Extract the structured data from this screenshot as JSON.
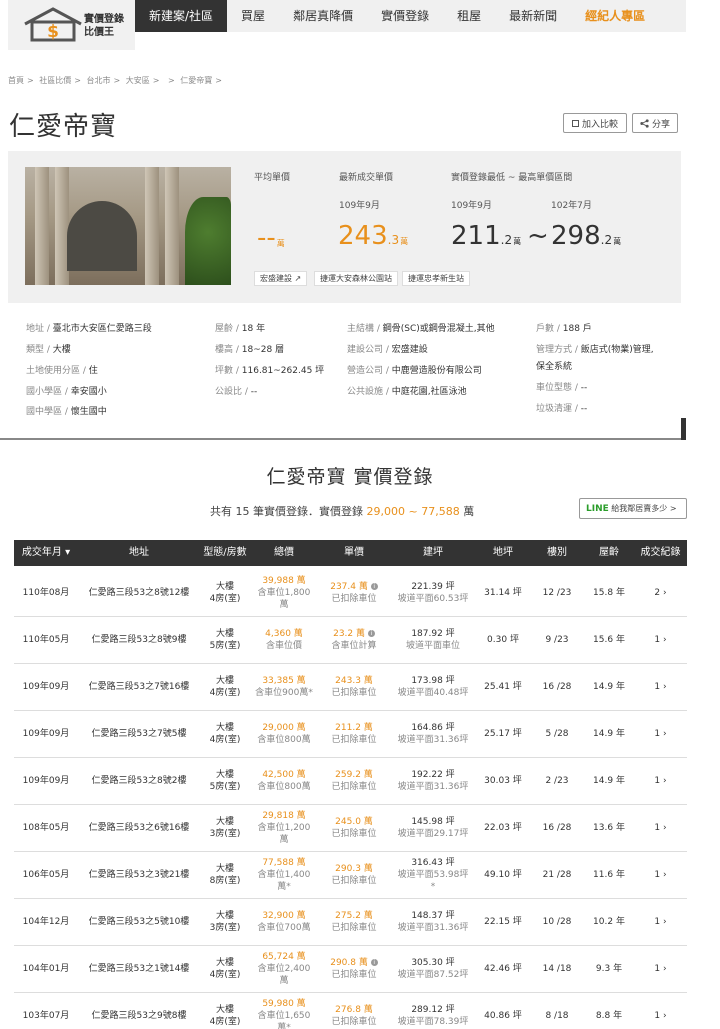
{
  "logo": {
    "line1": "實價登錄",
    "line2": "比價王"
  },
  "nav": [
    {
      "label": "新建案/社區",
      "active": true
    },
    {
      "label": "買屋"
    },
    {
      "label": "鄰居真降價"
    },
    {
      "label": "實價登錄"
    },
    {
      "label": "租屋"
    },
    {
      "label": "最新新聞"
    },
    {
      "label": "經紀人專區",
      "broker": true
    }
  ],
  "breadcrumb": [
    "首頁",
    "社區比價",
    "台北市",
    "大安區",
    "",
    "仁愛帝寶"
  ],
  "title": "仁愛帝寶",
  "buttons": {
    "compare": "加入比較",
    "share": "分享"
  },
  "summary": {
    "avg_label": "平均單價",
    "latest_label": "最新成交單價",
    "range_label": "實價登錄最低 ~ 最高單價區間",
    "avg_value": "--",
    "unit": "萬",
    "latest_date": "109年9月",
    "latest_int": "243",
    "latest_dec": ".3",
    "low_date": "109年9月",
    "low_int": "211",
    "low_dec": ".2",
    "tilde": "~",
    "high_date": "102年7月",
    "high_int": "298",
    "high_dec": ".2",
    "tags": [
      "宏盛建設",
      "捷運大安森林公園站",
      "捷運忠孝新生站"
    ]
  },
  "details": {
    "c1": [
      {
        "k": "地址 / ",
        "v": "臺北市大安區仁愛路三段"
      },
      {
        "k": "類型 / ",
        "v": "大樓"
      },
      {
        "k": "土地使用分區 / ",
        "v": "住"
      },
      {
        "k": "國小學區 / ",
        "v": "幸安國小"
      },
      {
        "k": "國中學區 / ",
        "v": "懷生國中"
      }
    ],
    "c2": [
      {
        "k": "屋齡 / ",
        "v": "18 年"
      },
      {
        "k": "樓高 / ",
        "v": "18~28 層"
      },
      {
        "k": "坪數 / ",
        "v": "116.81~262.45 坪"
      },
      {
        "k": "公設比 / ",
        "v": "--"
      }
    ],
    "c3": [
      {
        "k": "主結構 / ",
        "v": "鋼骨(SC)或鋼骨混凝土,其他"
      },
      {
        "k": "建設公司 / ",
        "v": "宏盛建設"
      },
      {
        "k": "營造公司 / ",
        "v": "中鹿營造股份有限公司"
      },
      {
        "k": "公共設施 / ",
        "v": "中庭花園,社區泳池"
      }
    ],
    "c4": [
      {
        "k": "戶數 / ",
        "v": "188 戶"
      },
      {
        "k": "管理方式 / ",
        "v": "飯店式(物業)管理,"
      },
      {
        "k": "",
        "v": "保全系統"
      },
      {
        "k": "車位型態 / ",
        "v": "--"
      },
      {
        "k": "垃圾清運 / ",
        "v": "--"
      }
    ]
  },
  "section": {
    "title": "仁愛帝寶 實價登錄",
    "sub_prefix": "共有 15 筆實價登錄．實價登錄 ",
    "sub_range": "29,000 ~ 77,588",
    "sub_suffix": " 萬",
    "line_logo": "LINE",
    "line_text": " 給我鄰居賣多少 >"
  },
  "table": {
    "headers": [
      "成交年月 ▾",
      "地址",
      "型態/房數",
      "總價",
      "單價",
      "建坪",
      "地坪",
      "樓別",
      "屋齡",
      "成交紀錄"
    ],
    "rows": [
      {
        "date": "110年08月",
        "addr": "仁愛路三段53之8號12樓",
        "type": "大樓",
        "rooms": "4房(室)",
        "total": "39,988 萬",
        "total_sub1": "含車位1,800",
        "total_sub2": "萬",
        "unit": "237.4 萬",
        "unit_info": true,
        "unit_sub": "已扣除車位",
        "bld": "221.39 坪",
        "bld_sub": "坡道平面60.53坪",
        "bld_sub2": "",
        "land": "31.14 坪",
        "floor": "12 /23",
        "age": "15.8 年",
        "rec": "2 ›"
      },
      {
        "date": "110年05月",
        "addr": "仁愛路三段53之8號9樓",
        "type": "大樓",
        "rooms": "5房(室)",
        "total": "4,360 萬",
        "total_sub1": "含車位價",
        "total_sub2": "",
        "unit": "23.2 萬",
        "unit_info": true,
        "unit_sub": "含車位計算",
        "bld": "187.92 坪",
        "bld_sub": "坡道平面車位",
        "bld_sub2": "",
        "land": "0.30 坪",
        "floor": "9 /23",
        "age": "15.6 年",
        "rec": "1 ›"
      },
      {
        "date": "109年09月",
        "addr": "仁愛路三段53之7號16樓",
        "type": "大樓",
        "rooms": "4房(室)",
        "total": "33,385 萬",
        "total_sub1": "含車位900萬*",
        "total_sub2": "",
        "unit": "243.3 萬",
        "unit_info": false,
        "unit_sub": "已扣除車位",
        "bld": "173.98 坪",
        "bld_sub": "坡道平面40.48坪",
        "bld_sub2": "",
        "land": "25.41 坪",
        "floor": "16 /28",
        "age": "14.9 年",
        "rec": "1 ›"
      },
      {
        "date": "109年09月",
        "addr": "仁愛路三段53之7號5樓",
        "type": "大樓",
        "rooms": "4房(室)",
        "total": "29,000 萬",
        "total_sub1": "含車位800萬",
        "total_sub2": "",
        "unit": "211.2 萬",
        "unit_info": false,
        "unit_sub": "已扣除車位",
        "bld": "164.86 坪",
        "bld_sub": "坡道平面31.36坪",
        "bld_sub2": "",
        "land": "25.17 坪",
        "floor": "5 /28",
        "age": "14.9 年",
        "rec": "1 ›"
      },
      {
        "date": "109年09月",
        "addr": "仁愛路三段53之8號2樓",
        "type": "大樓",
        "rooms": "5房(室)",
        "total": "42,500 萬",
        "total_sub1": "含車位800萬",
        "total_sub2": "",
        "unit": "259.2 萬",
        "unit_info": false,
        "unit_sub": "已扣除車位",
        "bld": "192.22 坪",
        "bld_sub": "坡道平面31.36坪",
        "bld_sub2": "",
        "land": "30.03 坪",
        "floor": "2 /23",
        "age": "14.9 年",
        "rec": "1 ›"
      },
      {
        "date": "108年05月",
        "addr": "仁愛路三段53之6號16樓",
        "type": "大樓",
        "rooms": "3房(室)",
        "total": "29,818 萬",
        "total_sub1": "含車位1,200",
        "total_sub2": "萬",
        "unit": "245.0 萬",
        "unit_info": false,
        "unit_sub": "已扣除車位",
        "bld": "145.98 坪",
        "bld_sub": "坡道平面29.17坪",
        "bld_sub2": "",
        "land": "22.03 坪",
        "floor": "16 /28",
        "age": "13.6 年",
        "rec": "1 ›"
      },
      {
        "date": "106年05月",
        "addr": "仁愛路三段53之3號21樓",
        "type": "大樓",
        "rooms": "8房(室)",
        "total": "77,588 萬",
        "total_sub1": "含車位1,400",
        "total_sub2": "萬*",
        "unit": "290.3 萬",
        "unit_info": false,
        "unit_sub": "已扣除車位",
        "bld": "316.43 坪",
        "bld_sub": "坡道平面53.98坪",
        "bld_sub2": "*",
        "land": "49.10 坪",
        "floor": "21 /28",
        "age": "11.6 年",
        "rec": "1 ›"
      },
      {
        "date": "104年12月",
        "addr": "仁愛路三段53之5號10樓",
        "type": "大樓",
        "rooms": "3房(室)",
        "total": "32,900 萬",
        "total_sub1": "含車位700萬",
        "total_sub2": "",
        "unit": "275.2 萬",
        "unit_info": false,
        "unit_sub": "已扣除車位",
        "bld": "148.37 坪",
        "bld_sub": "坡道平面31.36坪",
        "bld_sub2": "",
        "land": "22.15 坪",
        "floor": "10 /28",
        "age": "10.2 年",
        "rec": "1 ›"
      },
      {
        "date": "104年01月",
        "addr": "仁愛路三段53之1號14樓",
        "type": "大樓",
        "rooms": "4房(室)",
        "total": "65,724 萬",
        "total_sub1": "含車位2,400",
        "total_sub2": "萬",
        "unit": "290.8 萬",
        "unit_info": true,
        "unit_sub": "已扣除車位",
        "bld": "305.30 坪",
        "bld_sub": "坡道平面87.52坪",
        "bld_sub2": "",
        "land": "42.46 坪",
        "floor": "14 /18",
        "age": "9.3 年",
        "rec": "1 ›"
      },
      {
        "date": "103年07月",
        "addr": "仁愛路三段53之9號8樓",
        "type": "大樓",
        "rooms": "4房(室)",
        "total": "59,980 萬",
        "total_sub1": "含車位1,650",
        "total_sub2": "萬*",
        "unit": "276.8 萬",
        "unit_info": false,
        "unit_sub": "已扣除車位",
        "bld": "289.12 坪",
        "bld_sub": "坡道平面78.39坪",
        "bld_sub2": "",
        "land": "40.86 坪",
        "floor": "8 /18",
        "age": "8.8 年",
        "rec": "1 ›"
      }
    ]
  }
}
